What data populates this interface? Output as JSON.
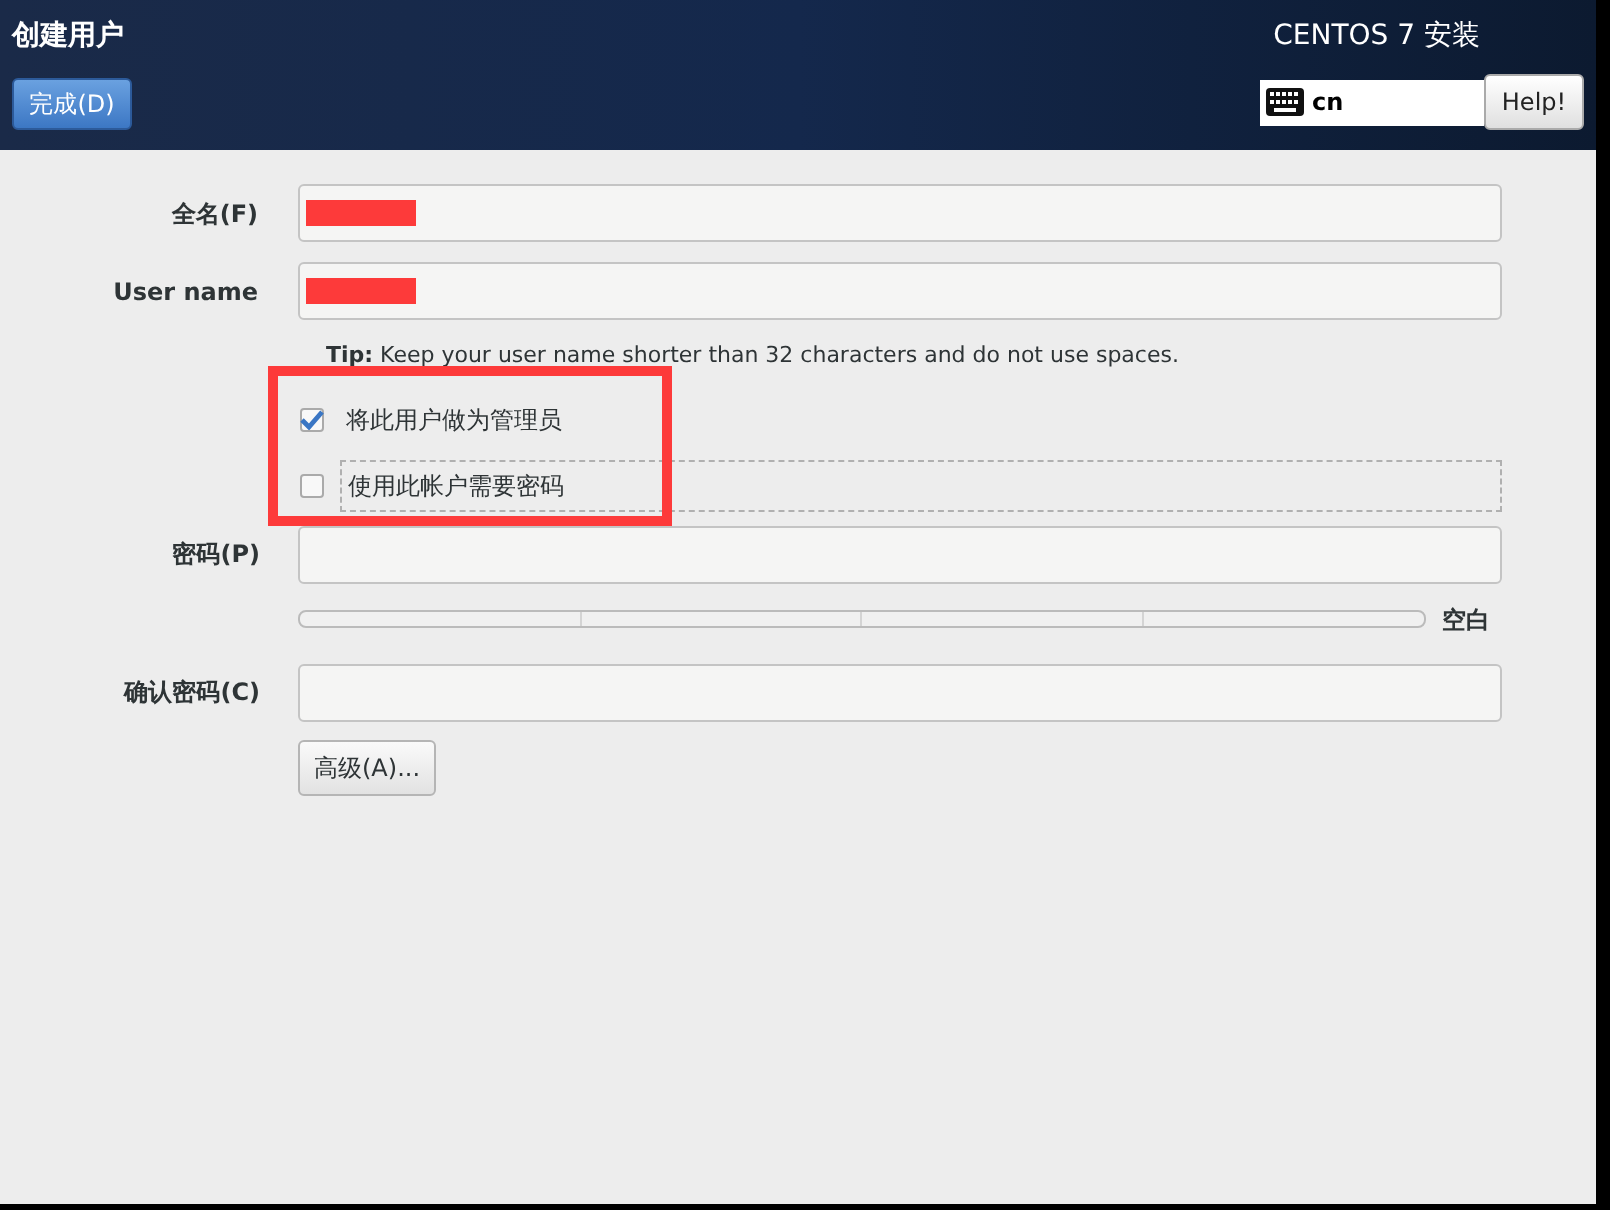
{
  "header": {
    "title": "创建用户",
    "done_button": "完成(D)",
    "product": "CENTOS 7 安装",
    "keyboard": "cn",
    "help_button": "Help!"
  },
  "fields": [
    {
      "label": "全名(F)",
      "redacted": true
    },
    {
      "label": "User name",
      "redacted": true
    }
  ],
  "tip": "**Tip:** Keep your user name shorter than 32 characters and do not use spaces.",
  "options": [
    {
      "label": "将此用户做为管理员",
      "checked": true
    },
    {
      "label": "使用此帐户需要密码",
      "checked": false
    }
  ],
  "password": {
    "label": "密码(P)",
    "strength": {
      "reading": "空白"
    }
  },
  "confirm": {
    "label": "确认密码(C)"
  },
  "advanced_button": "高级(A)..."
}
